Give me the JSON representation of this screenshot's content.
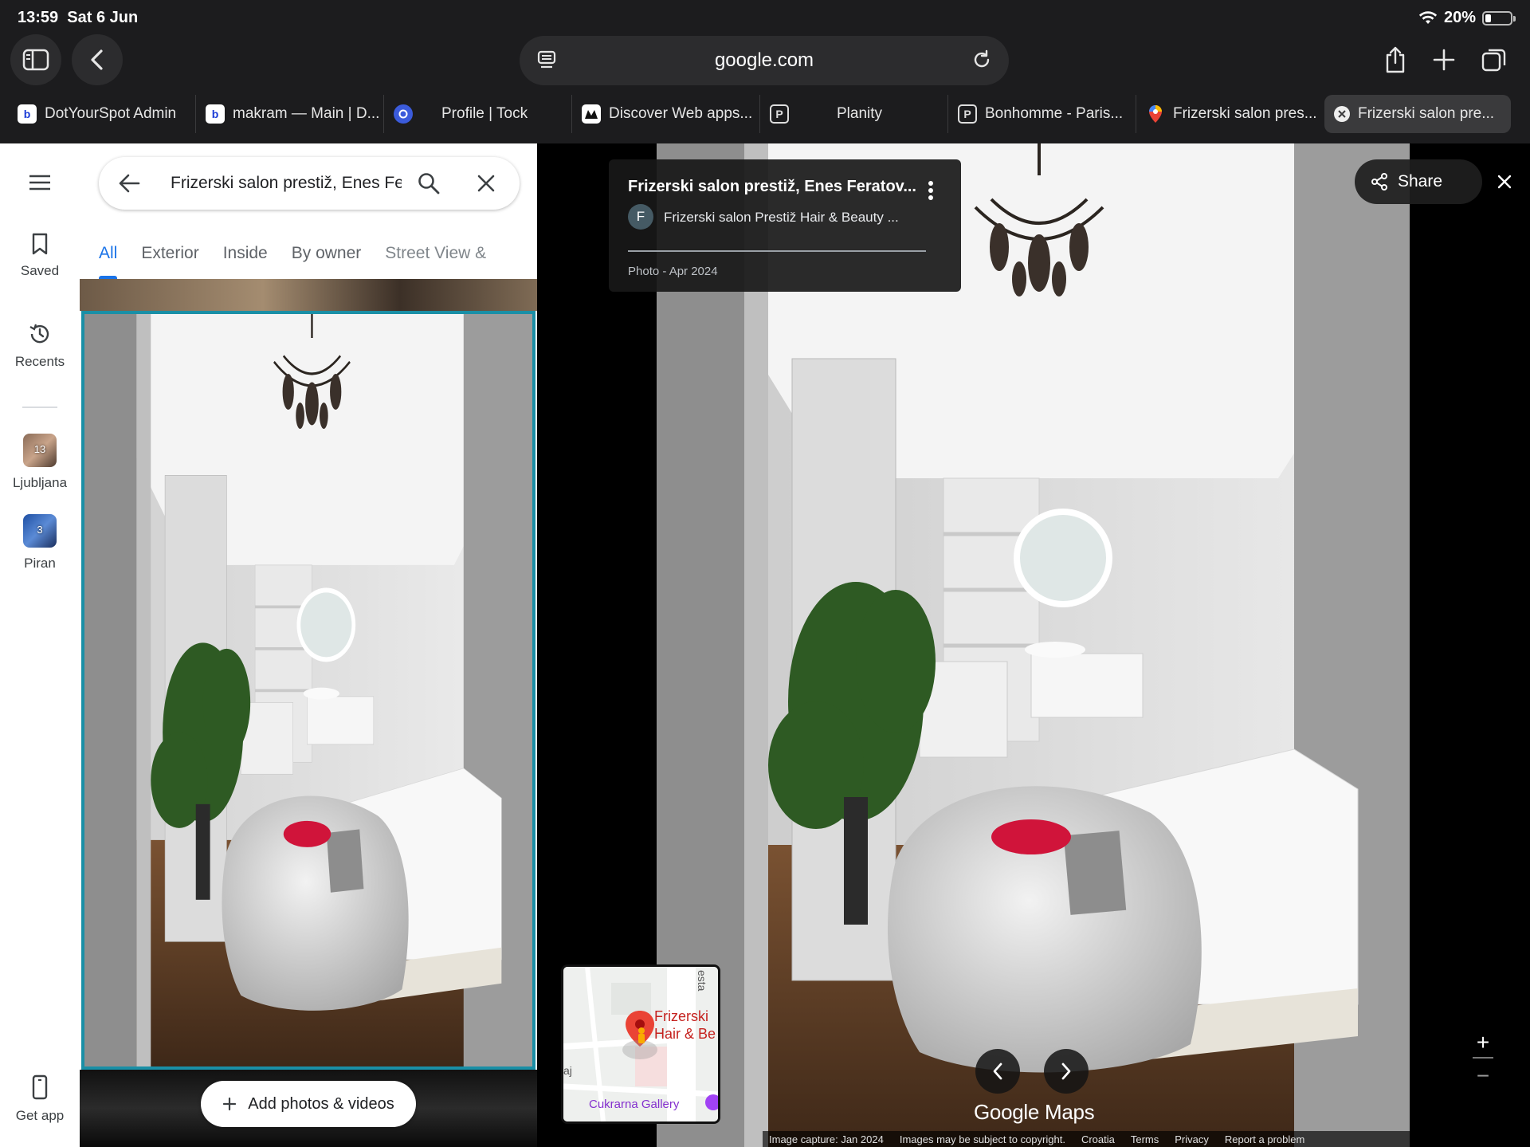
{
  "status": {
    "time": "13:59",
    "date": "Sat 6 Jun",
    "battery": "20%"
  },
  "browser": {
    "url": "google.com",
    "tabs": [
      {
        "label": "DotYourSpot Admin",
        "icon": "b-icon"
      },
      {
        "label": "makram — Main | D...",
        "icon": "b-icon"
      },
      {
        "label": "Profile | Tock",
        "icon": "tock-icon"
      },
      {
        "label": "Discover Web apps...",
        "icon": "web-apps-icon"
      },
      {
        "label": "Planity",
        "icon": "p-icon"
      },
      {
        "label": "Bonhomme - Paris...",
        "icon": "p-icon"
      },
      {
        "label": "Frizerski salon pres...",
        "icon": "maps-pin-icon"
      },
      {
        "label": "Frizerski salon pre...",
        "icon": "close-icon"
      }
    ]
  },
  "rail": {
    "saved": "Saved",
    "recents": "Recents",
    "recent_places": [
      {
        "label": "Ljubljana",
        "count": "13"
      },
      {
        "label": "Piran",
        "count": "3"
      }
    ],
    "get_app": "Get app"
  },
  "panel": {
    "search_value": "Frizerski salon prestiž, Enes Fe",
    "tabs": [
      "All",
      "Exterior",
      "Inside",
      "By owner",
      "Street View &"
    ],
    "selected_tab": "All",
    "add_button": "Add photos & videos"
  },
  "viewer": {
    "title": "Frizerski salon prestiž, Enes Feratov...",
    "avatar_letter": "F",
    "contributor": "Frizerski salon Prestiž Hair & Beauty ...",
    "photo_date": "Photo - Apr 2024",
    "share": "Share",
    "map_label_1": "Frizerski",
    "map_label_2": "Hair & Be",
    "map_street": "esta",
    "map_gallery": "Cukrarna Gallery",
    "map_edge": "aj",
    "brand": "Google Maps",
    "footer": {
      "capture": "Image capture: Jan 2024",
      "copyright": "Images may be subject to copyright.",
      "country": "Croatia",
      "terms": "Terms",
      "privacy": "Privacy",
      "report": "Report a problem"
    }
  },
  "colors": {
    "accent": "#1a73e8",
    "selected_border": "#1a8fa6",
    "chrome": "#1c1c1e"
  }
}
